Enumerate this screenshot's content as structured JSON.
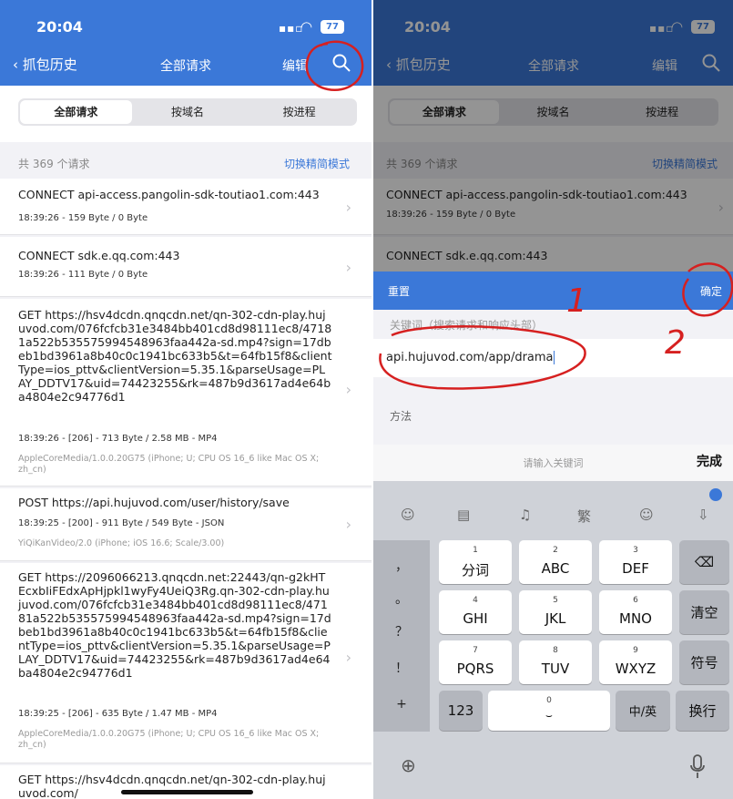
{
  "status": {
    "time": "20:04",
    "battery": "77"
  },
  "nav": {
    "back": "抓包历史",
    "title": "全部请求",
    "edit": "编辑"
  },
  "tabs": [
    {
      "label": "全部请求",
      "active": true
    },
    {
      "label": "按域名",
      "active": false
    },
    {
      "label": "按进程",
      "active": false
    }
  ],
  "summary": {
    "count": "共 369 个请求",
    "mode_link": "切换精简模式"
  },
  "requests": [
    {
      "url": "CONNECT api-access.pangolin-sdk-toutiao1.com:443",
      "meta": "18:39:26 - 159 Byte / 0 Byte",
      "ua": ""
    },
    {
      "url": "CONNECT sdk.e.qq.com:443",
      "meta": "18:39:26 - 111 Byte / 0 Byte",
      "ua": ""
    },
    {
      "url": "GET https://hsv4dcdn.qnqcdn.net/qn-302-cdn-play.hujuvod.com/076fcfcb31e3484bb401cd8d98111ec8/47181a522b535575994548963faa442a-sd.mp4?sign=17dbeb1bd3961a8b40c0c1941bc633b5&t=64fb15f8&clientType=ios_pttv&clientVersion=5.35.1&parseUsage=PLAY_DDTV17&uid=74423255&rk=487b9d3617ad4e64ba4804e2c94776d1",
      "meta": "18:39:26 - [206] - 713 Byte / 2.58 MB - MP4",
      "ua": "AppleCoreMedia/1.0.0.20G75 (iPhone; U; CPU OS 16_6 like Mac OS X; zh_cn)"
    },
    {
      "url": "POST https://api.hujuvod.com/user/history/save",
      "meta": "18:39:25 - [200] - 911 Byte / 549 Byte - JSON",
      "ua": "YiQiKanVideo/2.0 (iPhone; iOS 16.6; Scale/3.00)"
    },
    {
      "url": "GET https://2096066213.qnqcdn.net:22443/qn-g2kHTEcxbIiFEdxApHjpkl1wyFy4UeiQ3Rg.qn-302-cdn-play.hujuvod.com/076fcfcb31e3484bb401cd8d98111ec8/47181a522b535575994548963faa442a-sd.mp4?sign=17dbeb1bd3961a8b40c0c1941bc633b5&t=64fb15f8&clientType=ios_pttv&clientVersion=5.35.1&parseUsage=PLAY_DDTV17&uid=74423255&rk=487b9d3617ad4e64ba4804e2c94776d1",
      "meta": "18:39:25 - [206] - 635 Byte / 1.47 MB - MP4",
      "ua": "AppleCoreMedia/1.0.0.20G75 (iPhone; U; CPU OS 16_6 like Mac OS X; zh_cn)"
    },
    {
      "url": "GET https://hsv4dcdn.qnqcdn.net/qn-302-cdn-play.hujuvod.com/",
      "meta": "",
      "ua": ""
    }
  ],
  "filter": {
    "reset": "重置",
    "confirm": "确定",
    "keyword_label": "关键词（搜索请求和响应头部）",
    "keyword_value": "api.hujuvod.com/app/drama",
    "method_label": "方法"
  },
  "keyboard": {
    "placeholder": "请输入关键词",
    "done": "完成",
    "side_keys": [
      "，",
      "。",
      "？",
      "！",
      "+"
    ],
    "rows": [
      [
        {
          "n": "1",
          "l": "分词"
        },
        {
          "n": "2",
          "l": "ABC"
        },
        {
          "n": "3",
          "l": "DEF"
        }
      ],
      [
        {
          "n": "4",
          "l": "GHI"
        },
        {
          "n": "5",
          "l": "JKL"
        },
        {
          "n": "6",
          "l": "MNO"
        }
      ],
      [
        {
          "n": "7",
          "l": "PQRS"
        },
        {
          "n": "8",
          "l": "TUV"
        },
        {
          "n": "9",
          "l": "WXYZ"
        }
      ]
    ],
    "delete": "⌫",
    "clear": "清空",
    "symbols": "符号",
    "num_key": "123",
    "space_num": "0",
    "lang_key": "中/英",
    "newline": "换行",
    "tool_trad": "繁"
  },
  "annotations": {
    "one": "1",
    "two": "2"
  },
  "colors": {
    "accent": "#3b78d8",
    "annotation": "#d62020"
  }
}
